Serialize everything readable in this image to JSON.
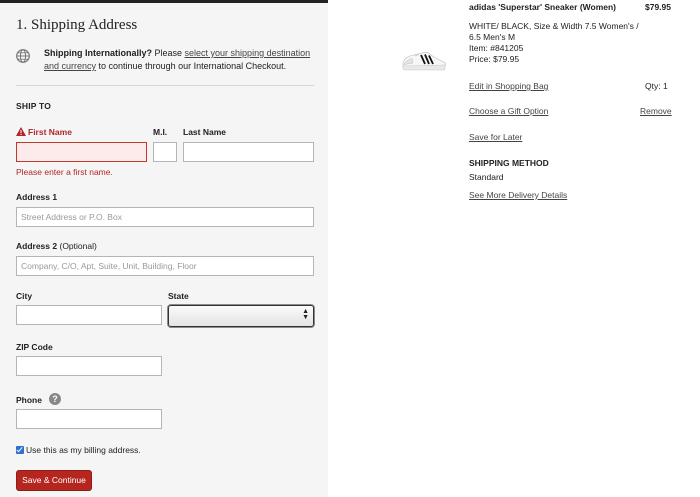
{
  "shipping": {
    "section_title": "1. Shipping Address",
    "intl": {
      "bold": "Shipping Internationally?",
      "text_before": " Please ",
      "link": "select your shipping destination and currency",
      "text_after": " to continue through our International Checkout."
    },
    "ship_to_heading": "SHIP TO",
    "first_name": {
      "label": "First Name",
      "value": "",
      "error": "Please enter a first name."
    },
    "middle_initial": {
      "label": "M.I.",
      "value": ""
    },
    "last_name": {
      "label": "Last Name",
      "value": ""
    },
    "address1": {
      "label": "Address 1",
      "placeholder": "Street Address or P.O. Box"
    },
    "address2": {
      "label": "Address 2",
      "optional": "(Optional)",
      "placeholder": "Company, C/O, Apt, Suite, Unit, Building, Floor"
    },
    "city": {
      "label": "City",
      "value": ""
    },
    "state": {
      "label": "State",
      "value": ""
    },
    "zip": {
      "label": "ZIP Code",
      "value": ""
    },
    "phone": {
      "label": "Phone",
      "value": ""
    },
    "billing_checkbox": {
      "label": "Use this as my billing address.",
      "checked": true
    },
    "save_label": "Save & Continue"
  },
  "cart": {
    "product_name": "adidas 'Superstar' Sneaker (Women)",
    "price_total": "$79.95",
    "details_line1": "WHITE/ BLACK, Size & Width 7.5 Women's /",
    "details_line2": "6.5 Men's M",
    "item_label": "Item: #841205",
    "price_label": "Price: $79.95",
    "edit_link": "Edit in Shopping Bag",
    "qty_label": "Qty: 1",
    "gift_link": "Choose a Gift Option",
    "remove_link": "Remove",
    "save_later_link": "Save for Later",
    "shipping_method_heading": "SHIPPING METHOD",
    "shipping_method_value": "Standard",
    "delivery_link": "See More Delivery Details"
  },
  "colors": {
    "accent": "#b5261e",
    "error": "#b0262a",
    "error_bg": "#fdeaea",
    "checkbox": "#2f6fd1",
    "panel_bg": "#f5f5f5"
  },
  "icons": {
    "globe": "globe-icon",
    "warning": "warning-icon",
    "help": "help-icon",
    "select_arrows": "select-arrows-icon",
    "product": "sneaker-image"
  }
}
